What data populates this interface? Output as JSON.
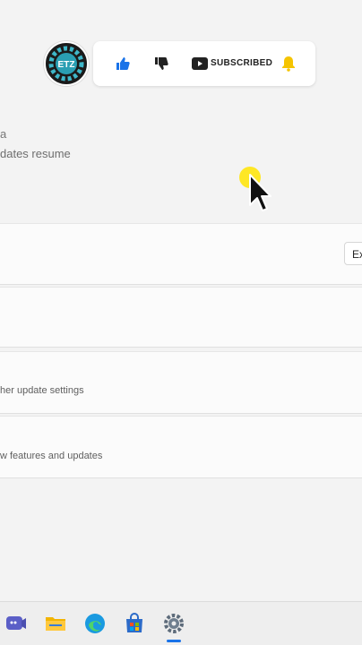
{
  "promo": {
    "avatar_label": "ETZ",
    "subscribed_label": "SUBSCRIBED",
    "icons": [
      "thumbs-up-icon",
      "thumbs-down-icon",
      "youtube-icon",
      "bell-icon"
    ]
  },
  "settings": {
    "partial_heading_fragment": "a",
    "pause_status_fragment": "dates resume",
    "cards": [
      {
        "subtitle": ""
      },
      {
        "subtitle": ""
      },
      {
        "subtitle": "her update settings"
      },
      {
        "subtitle": "w features and updates"
      }
    ],
    "expand_button_fragment": "Ex"
  },
  "taskbar": {
    "apps": [
      "meet-icon",
      "file-explorer-icon",
      "edge-icon",
      "store-icon",
      "settings-icon"
    ],
    "active_app": "settings-icon"
  },
  "colors": {
    "accent": "#1a73e8",
    "like": "#1a73e8",
    "cursor_halo": "#ffe400",
    "background": "#f3f3f3"
  }
}
